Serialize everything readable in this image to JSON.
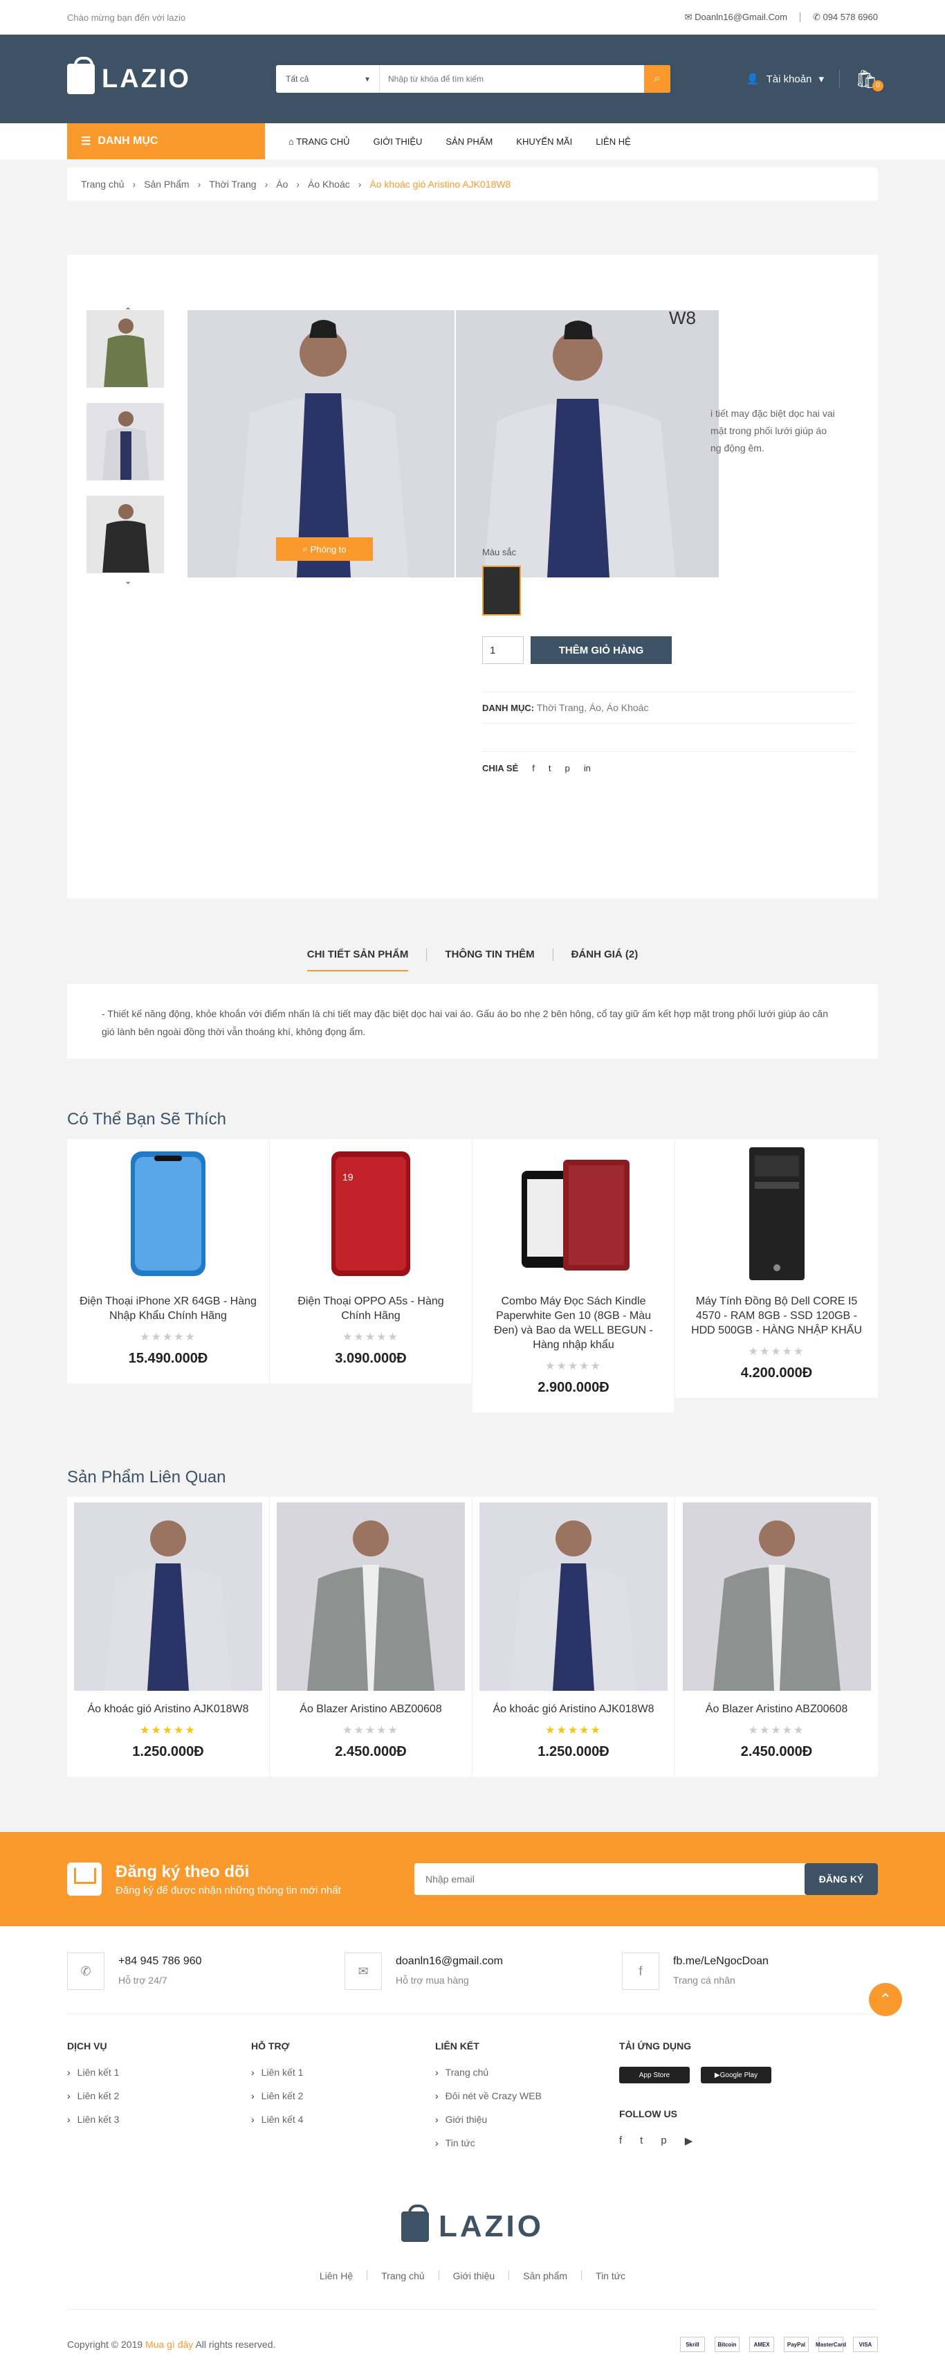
{
  "topbar": {
    "welcome": "Chào mừng bạn đến với lazio",
    "email": "Doanln16@Gmail.Com",
    "phone": "094 578 6960"
  },
  "header": {
    "logo": "LAZIO",
    "search": {
      "category": "Tất cả",
      "placeholder": "Nhập từ khóa để tìm kiếm"
    },
    "account": "Tài khoản",
    "cart_count": "0"
  },
  "nav": {
    "category_label": "DANH MỤC",
    "items": [
      "TRANG CHỦ",
      "GIỚI THIỆU",
      "SẢN PHẨM",
      "KHUYẾN MÃI",
      "LIÊN HỆ"
    ]
  },
  "breadcrumb": [
    "Trang chủ",
    "Sản Phẩm",
    "Thời Trang",
    "Áo",
    "Áo Khoác",
    "Áo khoác gió Aristino AJK018W8"
  ],
  "product": {
    "title_fragment": "W8",
    "desc_fragment": "i tiết may đặc biệt dọc hai vai\nmặt trong phối lưới giúp áo\nng động êm.",
    "zoom_label": "Phóng to",
    "color_label": "Màu sắc",
    "quantity": "1",
    "add_to_cart": "THÊM GIỎ HÀNG",
    "category_label": "DANH MỤC:",
    "category_value": "Thời Trang, Áo, Áo Khoác",
    "share_label": "CHIA SẺ"
  },
  "tabs": [
    {
      "label": "CHI TIẾT SẢN PHẨM",
      "active": true
    },
    {
      "label": "THÔNG TIN THÊM",
      "active": false
    },
    {
      "label": "ĐÁNH GIÁ (2)",
      "active": false
    }
  ],
  "tab_content": "- Thiết kế năng động, khỏe khoắn với điểm nhấn là chi tiết may đặc biệt dọc hai vai áo. Gấu áo bo nhẹ 2 bên hông, cổ tay giữ ấm kết hợp mặt trong phối lưới giúp áo căn gió lành bên ngoài đồng thời vẫn thoáng khí, không đọng ẩm.",
  "recommend": {
    "title": "Có Thể Bạn Sẽ Thích",
    "items": [
      {
        "name": "Điện Thoại iPhone XR 64GB - Hàng Nhập Khẩu Chính Hãng",
        "price": "15.490.000Đ",
        "rating": 0,
        "icon": "phone-blue-icon"
      },
      {
        "name": "Điện Thoại OPPO A5s - Hàng Chính Hãng",
        "price": "3.090.000Đ",
        "rating": 0,
        "icon": "phone-red-icon"
      },
      {
        "name": "Combo Máy Đọc Sách Kindle Paperwhite Gen 10 (8GB - Màu Đen) và Bao da WELL BEGUN - Hàng nhập khẩu",
        "price": "2.900.000Đ",
        "rating": 0,
        "icon": "ebook-reader-icon"
      },
      {
        "name": "Máy Tính Đồng Bộ Dell CORE I5 4570 - RAM 8GB - SSD 120GB - HDD 500GB - HÀNG NHẬP KHẨU",
        "price": "4.200.000Đ",
        "rating": 0,
        "icon": "desktop-tower-icon"
      }
    ]
  },
  "related": {
    "title": "Sản Phẩm Liên Quan",
    "items": [
      {
        "name": "Áo khoác gió Aristino AJK018W8",
        "price": "1.250.000Đ",
        "rating": 4.5
      },
      {
        "name": "Áo Blazer Aristino ABZ00608",
        "price": "2.450.000Đ",
        "rating": 0
      },
      {
        "name": "Áo khoác gió Aristino AJK018W8",
        "price": "1.250.000Đ",
        "rating": 4.5
      },
      {
        "name": "Áo Blazer Aristino ABZ00608",
        "price": "2.450.000Đ",
        "rating": 0
      }
    ]
  },
  "newsletter": {
    "title": "Đăng ký theo dõi",
    "subtitle": "Đăng ký để được nhận những thông tin mới nhất",
    "placeholder": "Nhập email",
    "button": "ĐĂNG KÝ"
  },
  "footer": {
    "contacts": [
      {
        "value": "+84 945 786 960",
        "sub": "Hỗ trợ 24/7",
        "icon": "phone-icon"
      },
      {
        "value": "doanln16@gmail.com",
        "sub": "Hỗ trợ mua hàng",
        "icon": "mail-icon"
      },
      {
        "value": "fb.me/LeNgocDoan",
        "sub": "Trang cá nhân",
        "icon": "facebook-icon"
      }
    ],
    "columns": [
      {
        "title": "DỊCH VỤ",
        "links": [
          "Liên kết 1",
          "Liên kết 2",
          "Liên kết 3"
        ]
      },
      {
        "title": "HỖ TRỢ",
        "links": [
          "Liên kết 1",
          "Liên kết 2",
          "Liên kết 4"
        ]
      },
      {
        "title": "LIÊN KẾT",
        "links": [
          "Trang chủ",
          "Đôi nét về Crazy WEB",
          "Giới thiệu",
          "Tin tức"
        ]
      }
    ],
    "app_title": "TẢI ỨNG DỤNG",
    "app_store": "App Store",
    "google_play": "Google Play",
    "follow_title": "FOLLOW US",
    "logo": "LAZIO",
    "links": [
      "Liên Hệ",
      "Trang chủ",
      "Giới thiệu",
      "Sản phẩm",
      "Tin tức"
    ],
    "copyright_prefix": "Copyright © 2019",
    "copyright_brand": "Mua gì đây",
    "copyright_suffix": "All rights reserved.",
    "payments": [
      "Skrill",
      "Bitcoin",
      "AMEX",
      "PayPal",
      "MasterCard",
      "VISA"
    ]
  },
  "colors": {
    "accent": "#fa9a2c",
    "navy": "#3e5266"
  }
}
